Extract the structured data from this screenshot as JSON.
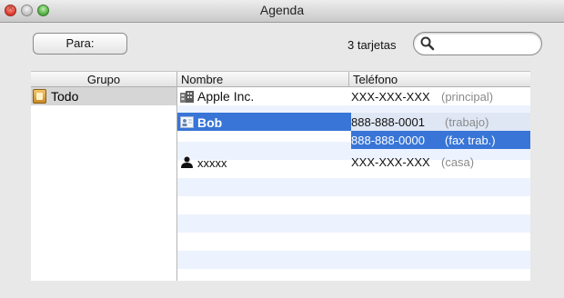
{
  "window": {
    "title": "Agenda"
  },
  "toolbar": {
    "para_label": "Para:",
    "card_count": "3 tarjetas",
    "search_placeholder": ""
  },
  "columns": {
    "grupo": "Grupo",
    "nombre": "Nombre",
    "telefono": "Teléfono"
  },
  "groups": [
    {
      "label": "Todo",
      "icon": "group-folder-icon"
    }
  ],
  "contacts": [
    {
      "name": "Apple Inc.",
      "icon": "company-icon",
      "phone": "XXX-XXX-XXX",
      "phone_label": "(principal)"
    },
    {
      "name": "Bob",
      "icon": "vcard-icon",
      "phone": "888-888-0001",
      "phone_label": "(trabajo)",
      "phone2": "888-888-0000",
      "phone2_label": "(fax trab.)"
    },
    {
      "name": "xxxxx",
      "icon": "person-icon",
      "phone": "XXX-XXX-XXX",
      "phone_label": "(casa)"
    }
  ],
  "colors": {
    "selection": "#3875d7",
    "stripe": "#edf3fe",
    "group_selected": "#d6d6d6"
  }
}
